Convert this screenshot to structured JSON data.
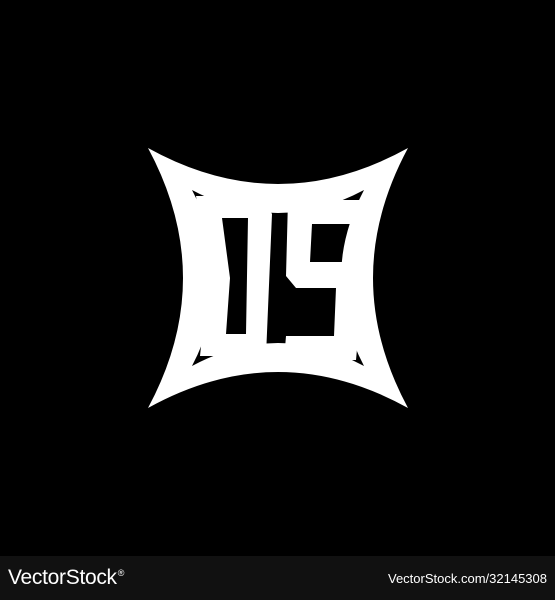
{
  "logo": {
    "monogram": "DS",
    "foreground_color": "#ffffff",
    "background_color": "#000000"
  },
  "watermark": {
    "brand": "VectorStock",
    "brand_mark": "®",
    "url": "VectorStock.com/32145308"
  }
}
